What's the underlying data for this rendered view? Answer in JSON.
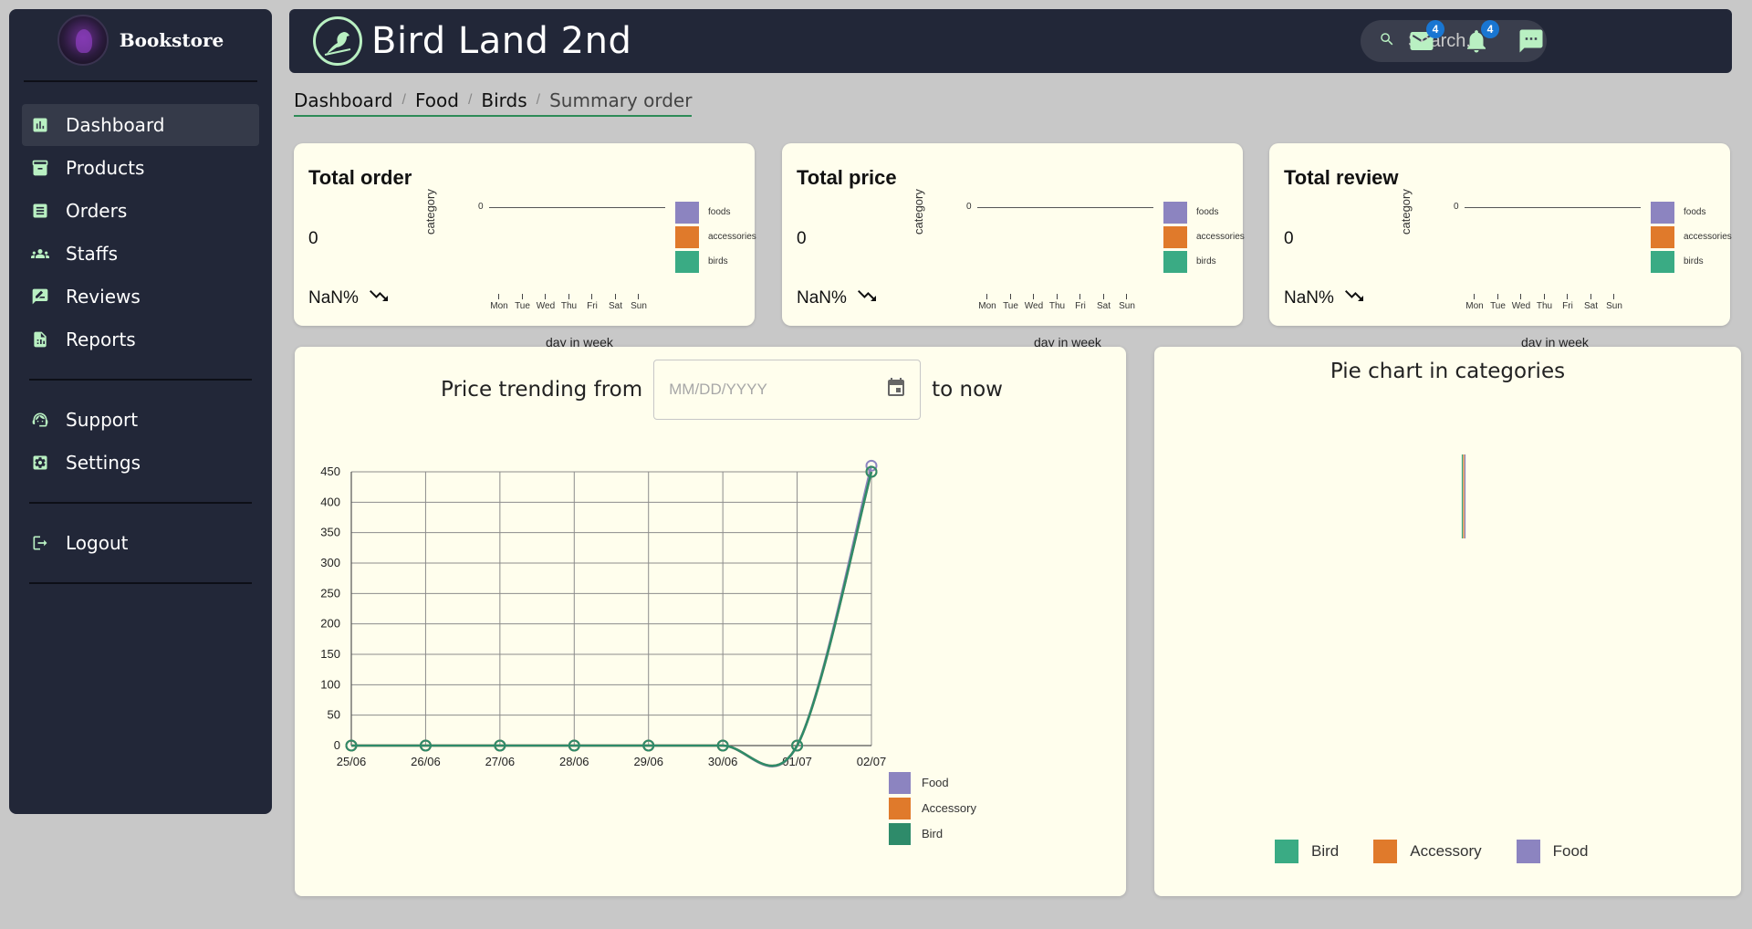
{
  "sidebar": {
    "brand": "Bookstore",
    "items": [
      {
        "label": "Dashboard",
        "icon": "chart-icon",
        "active": true
      },
      {
        "label": "Products",
        "icon": "archive-icon"
      },
      {
        "label": "Orders",
        "icon": "list-icon"
      },
      {
        "label": "Staffs",
        "icon": "people-icon"
      },
      {
        "label": "Reviews",
        "icon": "rate-review-icon"
      },
      {
        "label": "Reports",
        "icon": "report-icon"
      }
    ],
    "items2": [
      {
        "label": "Support",
        "icon": "support-icon"
      },
      {
        "label": "Settings",
        "icon": "settings-icon"
      }
    ],
    "logout": {
      "label": "Logout",
      "icon": "logout-icon"
    }
  },
  "header": {
    "title": "Bird Land 2nd",
    "search_placeholder": "Search...",
    "mail_badge": "4",
    "notif_badge": "4"
  },
  "breadcrumb": [
    "Dashboard",
    "Food",
    "Birds",
    "Summary order"
  ],
  "cards": [
    {
      "title": "Total order",
      "value": "0",
      "pct": "NaN%"
    },
    {
      "title": "Total price",
      "value": "0",
      "pct": "NaN%"
    },
    {
      "title": "Total review",
      "value": "0",
      "pct": "NaN%"
    }
  ],
  "mini_chart": {
    "ylabel": "category",
    "xlabel": "day in week",
    "zero_label": "0",
    "days": [
      "Mon",
      "Tue",
      "Wed",
      "Thu",
      "Fri",
      "Sat",
      "Sun"
    ],
    "legend": [
      {
        "name": "foods",
        "color": "#8c84c0"
      },
      {
        "name": "accessories",
        "color": "#e07a2b"
      },
      {
        "name": "birds",
        "color": "#3aab84"
      }
    ]
  },
  "trend": {
    "prefix": "Price trending from",
    "date_placeholder": "MM/DD/YYYY",
    "suffix": "to now"
  },
  "pie": {
    "title": "Pie chart in categories",
    "legend": [
      {
        "name": "Bird",
        "color": "#3aab84"
      },
      {
        "name": "Accessory",
        "color": "#e07a2b"
      },
      {
        "name": "Food",
        "color": "#8c84c0"
      }
    ]
  },
  "chart_data": {
    "type": "line",
    "x": [
      "25/06",
      "26/06",
      "27/06",
      "28/06",
      "29/06",
      "30/06",
      "01/07",
      "02/07"
    ],
    "ylim": [
      0,
      450
    ],
    "yticks": [
      0,
      50,
      100,
      150,
      200,
      250,
      300,
      350,
      400,
      450
    ],
    "grid": true,
    "legend_position": "bottom-right",
    "series": [
      {
        "name": "Food",
        "color": "#8c84c0",
        "values": [
          0,
          0,
          0,
          0,
          0,
          0,
          0,
          460
        ]
      },
      {
        "name": "Accessory",
        "color": "#e07a2b",
        "values": [
          0,
          0,
          0,
          0,
          0,
          0,
          0,
          450
        ]
      },
      {
        "name": "Bird",
        "color": "#2e8b6a",
        "values": [
          0,
          0,
          0,
          0,
          0,
          0,
          0,
          450
        ]
      }
    ]
  }
}
